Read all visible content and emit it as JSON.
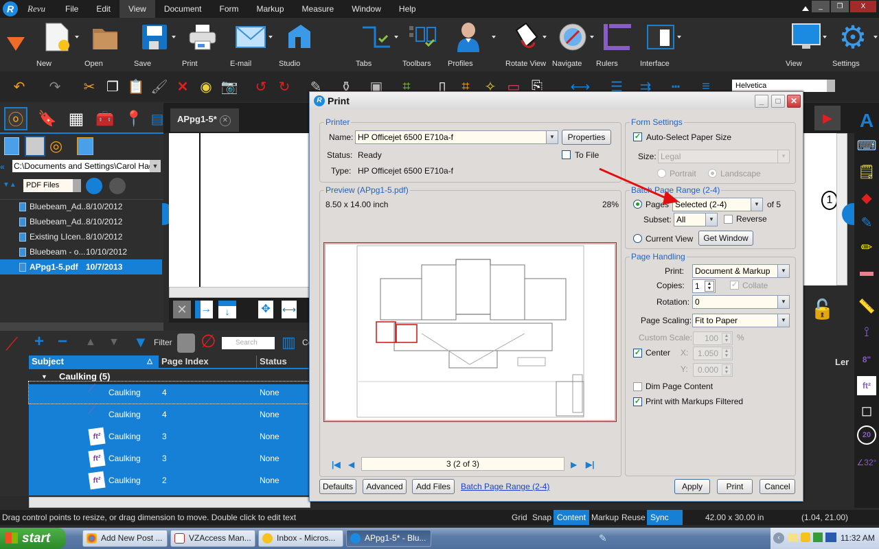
{
  "app": {
    "brand": "Revu",
    "menu": [
      "File",
      "Edit",
      "View",
      "Document",
      "Form",
      "Markup",
      "Measure",
      "Window",
      "Help"
    ],
    "active_menu": "View"
  },
  "big_toolbar": {
    "left": [
      {
        "label": "New",
        "icon": "new-document-icon"
      },
      {
        "label": "Open",
        "icon": "folder-icon"
      },
      {
        "label": "Save",
        "icon": "floppy-icon"
      },
      {
        "label": "Print",
        "icon": "printer-icon"
      },
      {
        "label": "E-mail",
        "icon": "envelope-icon"
      },
      {
        "label": "Studio",
        "icon": "studio-icon"
      },
      {
        "label": "Tabs",
        "icon": "tabs-icon"
      },
      {
        "label": "Toolbars",
        "icon": "toolbars-icon"
      },
      {
        "label": "Profiles",
        "icon": "profile-icon"
      },
      {
        "label": "Rotate View",
        "icon": "rotate-view-icon"
      },
      {
        "label": "Navigate",
        "icon": "compass-icon"
      },
      {
        "label": "Rulers",
        "icon": "ruler-icon"
      },
      {
        "label": "Interface",
        "icon": "interface-icon"
      }
    ],
    "right": [
      {
        "label": "View",
        "icon": "monitor-icon"
      },
      {
        "label": "Settings",
        "icon": "gear-icon"
      }
    ]
  },
  "font_box": {
    "value": "Helvetica"
  },
  "left_panel": {
    "path": "C:\\Documents and Settings\\Carol  Hage",
    "filter": "PDF Files",
    "files": [
      {
        "name": "Bluebeam_Ad...",
        "date": "8/10/2012",
        "selected": false
      },
      {
        "name": "Bluebeam_Ad...",
        "date": "8/10/2012",
        "selected": false
      },
      {
        "name": "Existing LIcen...",
        "date": "8/10/2012",
        "selected": false
      },
      {
        "name": "Bluebeam - o...",
        "date": "10/10/2012",
        "selected": false
      },
      {
        "name": "APpg1-5.pdf",
        "date": "10/7/2013",
        "selected": true
      }
    ]
  },
  "doc_tab": {
    "title": "APpg1-5*"
  },
  "markups": {
    "toolbar": {
      "filter_label": "Filter",
      "search_placeholder": "Search",
      "columns_label": "Co"
    },
    "columns": [
      "Subject",
      "Page Index",
      "Status",
      "Ler"
    ],
    "group": "Caulking (5)",
    "rows": [
      {
        "subject": "Caulking",
        "page": "4",
        "status": "None",
        "icon": "length-icon"
      },
      {
        "subject": "Caulking",
        "page": "4",
        "status": "None",
        "icon": "length-icon"
      },
      {
        "subject": "Caulking",
        "page": "3",
        "status": "None",
        "icon": "area-icon"
      },
      {
        "subject": "Caulking",
        "page": "3",
        "status": "None",
        "icon": "area-icon"
      },
      {
        "subject": "Caulking",
        "page": "2",
        "status": "None",
        "icon": "area-icon"
      }
    ]
  },
  "status_bar": {
    "message": "Drag control points to resize, or drag dimension to move. Double click to edit text",
    "toggles": [
      {
        "label": "Grid",
        "on": false
      },
      {
        "label": "Snap",
        "on": false
      },
      {
        "label": "Content",
        "on": true
      },
      {
        "label": "Markup",
        "on": false
      },
      {
        "label": "Reuse",
        "on": false
      },
      {
        "label": "Sync",
        "on": true
      }
    ],
    "page_size": "42.00 x 30.00 in",
    "coords": "(1.04, 21.00)"
  },
  "taskbar": {
    "start": "start",
    "tasks": [
      {
        "label": "Add New Post ...",
        "active": false
      },
      {
        "label": "VZAccess Man...",
        "active": false
      },
      {
        "label": "Inbox - Micros...",
        "active": false
      },
      {
        "label": "APpg1-5* - Blu...",
        "active": true
      }
    ],
    "clock": "11:32 AM"
  },
  "print_dialog": {
    "title": "Print",
    "printer": {
      "group": "Printer",
      "name_label": "Name:",
      "name": "HP Officejet 6500 E710a-f",
      "properties_btn": "Properties",
      "status_label": "Status:",
      "status": "Ready",
      "to_file_label": "To File",
      "to_file": false,
      "type_label": "Type:",
      "type": "HP Officejet 6500 E710a-f"
    },
    "preview": {
      "group": "Preview (APpg1-5.pdf)",
      "size": "8.50  x  14.00 inch",
      "zoom": "28%",
      "page_field": "3 (2 of 3)"
    },
    "form_settings": {
      "group": "Form Settings",
      "auto_select_label": "Auto-Select Paper Size",
      "auto_select": true,
      "size_label": "Size:",
      "size": "Legal",
      "portrait_label": "Portrait",
      "landscape_label": "Landscape",
      "orientation": "Landscape"
    },
    "batch": {
      "group": "Batch Page Range (2-4)",
      "pages_label": "Pages",
      "pages_value": "Selected (2-4)",
      "of_label": "of 5",
      "subset_label": "Subset:",
      "subset": "All",
      "reverse_label": "Reverse",
      "reverse": false,
      "current_view_label": "Current View",
      "get_window_btn": "Get Window",
      "mode": "Pages"
    },
    "page_handling": {
      "group": "Page Handling",
      "print_label": "Print:",
      "print": "Document & Markup",
      "copies_label": "Copies:",
      "copies": "1",
      "collate_label": "Collate",
      "collate": true,
      "rotation_label": "Rotation:",
      "rotation": "0",
      "scaling_label": "Page Scaling:",
      "scaling": "Fit to Paper",
      "custom_scale_label": "Custom Scale:",
      "custom_scale": "100",
      "percent": "%",
      "center_label": "Center",
      "center": true,
      "x_label": "X:",
      "x": "1.050",
      "y_label": "Y:",
      "y": "0.000",
      "dim_label": "Dim Page Content",
      "dim": false,
      "filtered_label": "Print with Markups Filtered",
      "filtered": true
    },
    "buttons": {
      "defaults": "Defaults",
      "advanced": "Advanced",
      "add_files": "Add Files",
      "batch_link": "Batch Page Range (2-4)",
      "apply": "Apply",
      "print": "Print",
      "cancel": "Cancel"
    }
  }
}
